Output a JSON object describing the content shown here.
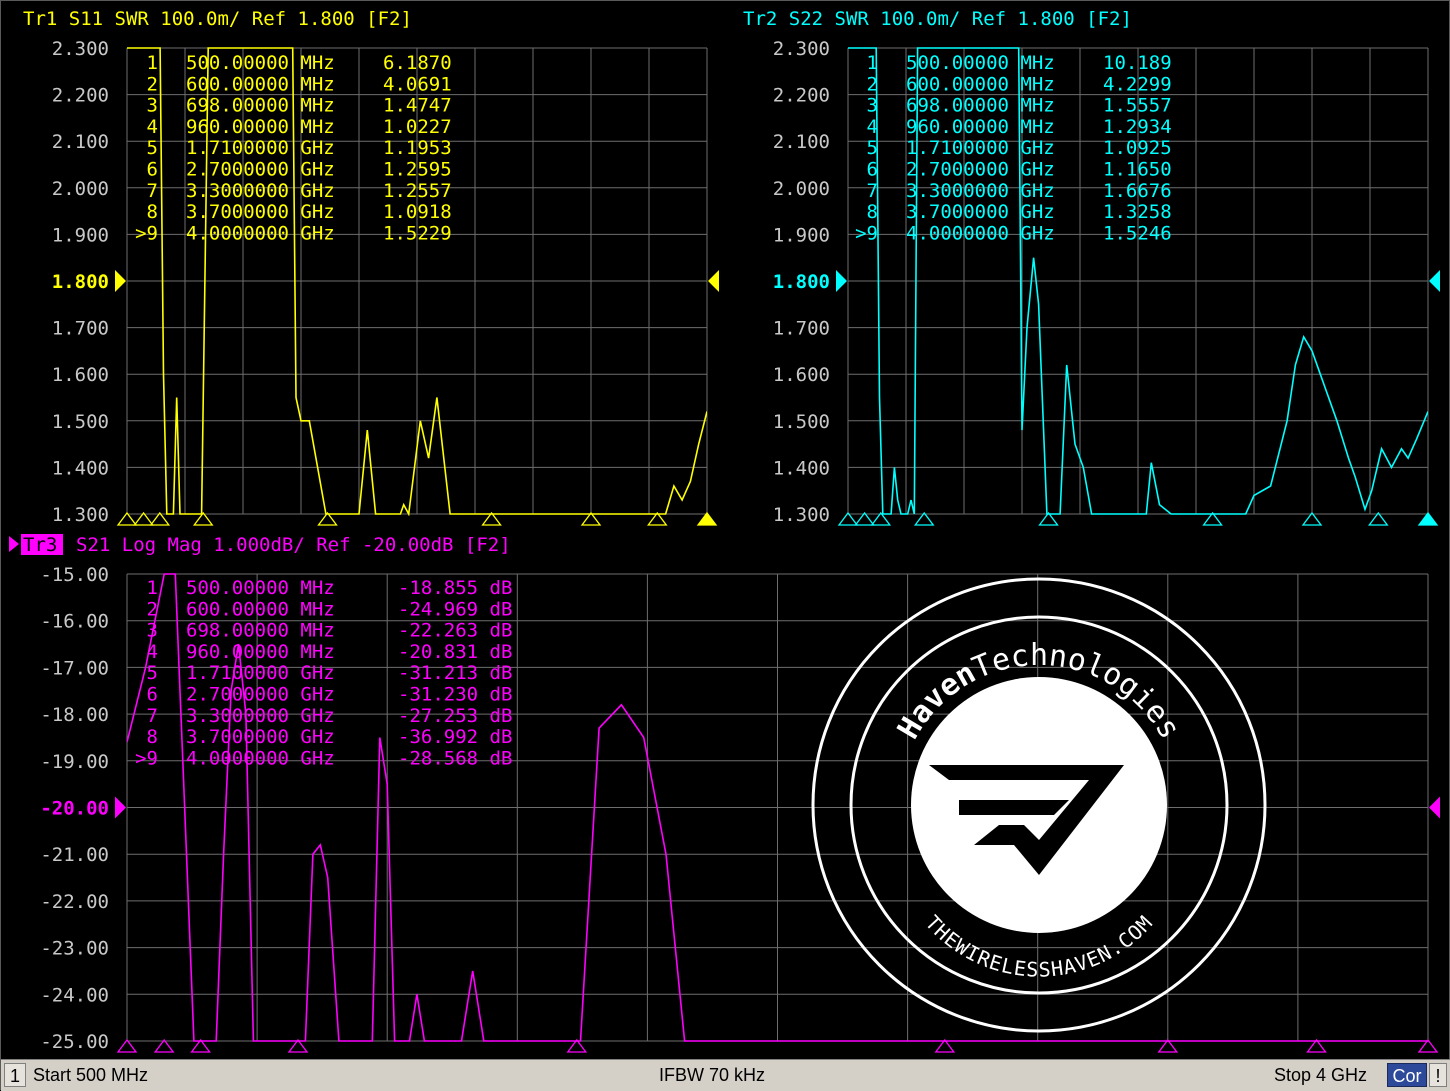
{
  "traces": [
    {
      "id": "tr1",
      "title": "Tr1 S11 SWR 100.0m/ Ref 1.800 [F2]",
      "active": false,
      "color": "#ffff00",
      "y_labels": [
        "2.300",
        "2.200",
        "2.100",
        "2.000",
        "1.900",
        "1.800",
        "1.700",
        "1.600",
        "1.500",
        "1.400",
        "1.300"
      ],
      "ref_label": "1.800",
      "ylim": [
        1.3,
        2.3
      ],
      "markers": [
        {
          "num": "1",
          "freq": "500.00000 MHz",
          "value": "6.1870"
        },
        {
          "num": "2",
          "freq": "600.00000 MHz",
          "value": "4.0691"
        },
        {
          "num": "3",
          "freq": "698.00000 MHz",
          "value": "1.4747"
        },
        {
          "num": "4",
          "freq": "960.00000 MHz",
          "value": "1.0227"
        },
        {
          "num": "5",
          "freq": "1.7100000 GHz",
          "value": "1.1953"
        },
        {
          "num": "6",
          "freq": "2.7000000 GHz",
          "value": "1.2595"
        },
        {
          "num": "7",
          "freq": "3.3000000 GHz",
          "value": "1.2557"
        },
        {
          "num": "8",
          "freq": "3.7000000 GHz",
          "value": "1.0918"
        },
        {
          "num": ">9",
          "freq": "4.0000000 GHz",
          "value": "1.5229"
        }
      ],
      "chart_data": {
        "type": "line",
        "x_unit": "GHz",
        "xlim": [
          0.5,
          4.0
        ],
        "ylim": [
          1.3,
          2.3
        ],
        "points": [
          [
            0.5,
            2.3
          ],
          [
            0.7,
            2.3
          ],
          [
            0.72,
            1.6
          ],
          [
            0.74,
            1.3
          ],
          [
            0.76,
            1.3
          ],
          [
            0.78,
            1.3
          ],
          [
            0.8,
            1.55
          ],
          [
            0.82,
            1.3
          ],
          [
            0.85,
            1.3
          ],
          [
            0.9,
            1.3
          ],
          [
            0.95,
            1.3
          ],
          [
            0.99,
            2.3
          ],
          [
            1.5,
            2.3
          ],
          [
            1.52,
            1.55
          ],
          [
            1.55,
            1.5
          ],
          [
            1.6,
            1.5
          ],
          [
            1.65,
            1.4
          ],
          [
            1.7,
            1.3
          ],
          [
            1.9,
            1.3
          ],
          [
            1.95,
            1.48
          ],
          [
            2.0,
            1.3
          ],
          [
            2.15,
            1.3
          ],
          [
            2.17,
            1.32
          ],
          [
            2.2,
            1.3
          ],
          [
            2.27,
            1.5
          ],
          [
            2.32,
            1.42
          ],
          [
            2.37,
            1.55
          ],
          [
            2.45,
            1.3
          ],
          [
            2.6,
            1.3
          ],
          [
            3.0,
            1.3
          ],
          [
            3.5,
            1.3
          ],
          [
            3.75,
            1.3
          ],
          [
            3.8,
            1.36
          ],
          [
            3.85,
            1.33
          ],
          [
            3.9,
            1.37
          ],
          [
            3.95,
            1.45
          ],
          [
            4.0,
            1.52
          ]
        ]
      }
    },
    {
      "id": "tr2",
      "title": "Tr2 S22 SWR 100.0m/ Ref 1.800 [F2]",
      "active": false,
      "color": "#00ffff",
      "y_labels": [
        "2.300",
        "2.200",
        "2.100",
        "2.000",
        "1.900",
        "1.800",
        "1.700",
        "1.600",
        "1.500",
        "1.400",
        "1.300"
      ],
      "ref_label": "1.800",
      "ylim": [
        1.3,
        2.3
      ],
      "markers": [
        {
          "num": "1",
          "freq": "500.00000 MHz",
          "value": "10.189"
        },
        {
          "num": "2",
          "freq": "600.00000 MHz",
          "value": "4.2299"
        },
        {
          "num": "3",
          "freq": "698.00000 MHz",
          "value": "1.5557"
        },
        {
          "num": "4",
          "freq": "960.00000 MHz",
          "value": "1.2934"
        },
        {
          "num": "5",
          "freq": "1.7100000 GHz",
          "value": "1.0925"
        },
        {
          "num": "6",
          "freq": "2.7000000 GHz",
          "value": "1.1650"
        },
        {
          "num": "7",
          "freq": "3.3000000 GHz",
          "value": "1.6676"
        },
        {
          "num": "8",
          "freq": "3.7000000 GHz",
          "value": "1.3258"
        },
        {
          "num": ">9",
          "freq": "4.0000000 GHz",
          "value": "1.5246"
        }
      ],
      "chart_data": {
        "type": "line",
        "x_unit": "GHz",
        "xlim": [
          0.5,
          4.0
        ],
        "ylim": [
          1.3,
          2.3
        ],
        "points": [
          [
            0.5,
            2.3
          ],
          [
            0.67,
            2.3
          ],
          [
            0.69,
            1.55
          ],
          [
            0.71,
            1.3
          ],
          [
            0.76,
            1.3
          ],
          [
            0.78,
            1.4
          ],
          [
            0.8,
            1.33
          ],
          [
            0.82,
            1.3
          ],
          [
            0.86,
            1.3
          ],
          [
            0.88,
            1.33
          ],
          [
            0.9,
            1.3
          ],
          [
            0.92,
            2.3
          ],
          [
            1.53,
            2.3
          ],
          [
            1.55,
            1.48
          ],
          [
            1.58,
            1.7
          ],
          [
            1.62,
            1.85
          ],
          [
            1.65,
            1.75
          ],
          [
            1.7,
            1.3
          ],
          [
            1.78,
            1.3
          ],
          [
            1.82,
            1.62
          ],
          [
            1.87,
            1.45
          ],
          [
            1.92,
            1.4
          ],
          [
            1.97,
            1.3
          ],
          [
            2.3,
            1.3
          ],
          [
            2.33,
            1.41
          ],
          [
            2.38,
            1.32
          ],
          [
            2.45,
            1.3
          ],
          [
            2.9,
            1.3
          ],
          [
            2.95,
            1.34
          ],
          [
            3.05,
            1.36
          ],
          [
            3.15,
            1.5
          ],
          [
            3.2,
            1.62
          ],
          [
            3.25,
            1.68
          ],
          [
            3.3,
            1.65
          ],
          [
            3.35,
            1.6
          ],
          [
            3.45,
            1.5
          ],
          [
            3.52,
            1.42
          ],
          [
            3.56,
            1.38
          ],
          [
            3.62,
            1.31
          ],
          [
            3.66,
            1.35
          ],
          [
            3.72,
            1.44
          ],
          [
            3.78,
            1.4
          ],
          [
            3.84,
            1.44
          ],
          [
            3.88,
            1.42
          ],
          [
            3.93,
            1.46
          ],
          [
            4.0,
            1.52
          ]
        ]
      }
    },
    {
      "id": "tr3",
      "title": "S21 Log Mag 1.000dB/ Ref -20.00dB [F2]",
      "tag": "Tr3",
      "active": true,
      "color": "#ff00ff",
      "y_labels": [
        "-15.00",
        "-16.00",
        "-17.00",
        "-18.00",
        "-19.00",
        "-20.00",
        "-21.00",
        "-22.00",
        "-23.00",
        "-24.00",
        "-25.00"
      ],
      "ref_label": "-20.00",
      "ylim": [
        -25,
        -15
      ],
      "markers": [
        {
          "num": "1",
          "freq": "500.00000 MHz",
          "value": "-18.855 dB"
        },
        {
          "num": "2",
          "freq": "600.00000 MHz",
          "value": "-24.969 dB"
        },
        {
          "num": "3",
          "freq": "698.00000 MHz",
          "value": "-22.263 dB"
        },
        {
          "num": "4",
          "freq": "960.00000 MHz",
          "value": "-20.831 dB"
        },
        {
          "num": "5",
          "freq": "1.7100000 GHz",
          "value": "-31.213 dB"
        },
        {
          "num": "6",
          "freq": "2.7000000 GHz",
          "value": "-31.230 dB"
        },
        {
          "num": "7",
          "freq": "3.3000000 GHz",
          "value": "-27.253 dB"
        },
        {
          "num": "8",
          "freq": "3.7000000 GHz",
          "value": "-36.992 dB"
        },
        {
          "num": ">9",
          "freq": "4.0000000 GHz",
          "value": "-28.568 dB"
        }
      ],
      "chart_data": {
        "type": "line",
        "x_unit": "GHz",
        "xlim": [
          0.5,
          4.0
        ],
        "ylim": [
          -25,
          -15
        ],
        "points": [
          [
            0.5,
            -18.6
          ],
          [
            0.55,
            -17.0
          ],
          [
            0.6,
            -15.0
          ],
          [
            0.63,
            -15.0
          ],
          [
            0.65,
            -19.0
          ],
          [
            0.68,
            -25.0
          ],
          [
            0.74,
            -25.0
          ],
          [
            0.76,
            -21.0
          ],
          [
            0.78,
            -17.5
          ],
          [
            0.8,
            -16.5
          ],
          [
            0.82,
            -18.0
          ],
          [
            0.84,
            -25.0
          ],
          [
            0.98,
            -25.0
          ],
          [
            1.0,
            -21.0
          ],
          [
            1.02,
            -20.8
          ],
          [
            1.04,
            -21.5
          ],
          [
            1.07,
            -25.0
          ],
          [
            1.16,
            -25.0
          ],
          [
            1.18,
            -18.5
          ],
          [
            1.2,
            -19.5
          ],
          [
            1.22,
            -25.0
          ],
          [
            1.26,
            -25.0
          ],
          [
            1.28,
            -24.0
          ],
          [
            1.3,
            -25.0
          ],
          [
            1.4,
            -25.0
          ],
          [
            1.43,
            -23.5
          ],
          [
            1.46,
            -25.0
          ],
          [
            1.72,
            -25.0
          ],
          [
            1.77,
            -18.3
          ],
          [
            1.83,
            -17.8
          ],
          [
            1.89,
            -18.5
          ],
          [
            1.95,
            -21.0
          ],
          [
            2.0,
            -25.0
          ],
          [
            2.5,
            -25.0
          ],
          [
            4.0,
            -25.0
          ]
        ]
      }
    }
  ],
  "logo": {
    "brand_bold": "Haven",
    "brand_light": "Technologies",
    "url": "THEWIRELESSHAVEN.COM"
  },
  "status": {
    "channel": "1",
    "start": "Start 500 MHz",
    "ifbw": "IFBW 70 kHz",
    "stop": "Stop 4 GHz",
    "cor": "Cor",
    "alert": "!"
  }
}
